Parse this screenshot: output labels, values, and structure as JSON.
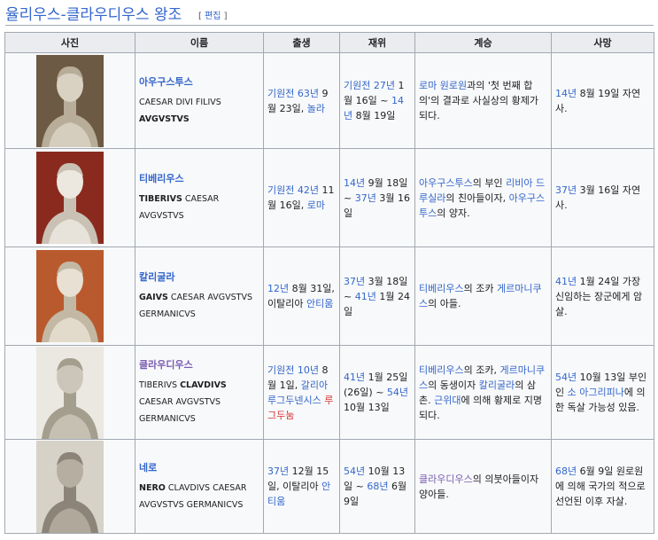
{
  "heading": {
    "title": "율리우스-클라우디우스 왕조",
    "edit_open": "[ ",
    "edit_label": "편집",
    "edit_close": " ]"
  },
  "table": {
    "headers": [
      "사진",
      "이름",
      "출생",
      "재위",
      "계승",
      "사망"
    ],
    "rows": [
      {
        "portrait_icon": "bust-portrait-augustus",
        "name": "아우구스투스",
        "latin": {
          "pre": "CAESAR DIVI FILIVS ",
          "bold": "AVGVSTVS",
          "post": ""
        },
        "birth": [
          {
            "t": "기원전 63년",
            "link": true
          },
          {
            "t": " 9월 23일, "
          },
          {
            "t": "놀라",
            "link": true
          }
        ],
        "reign": [
          {
            "t": "기원전 27년",
            "link": true
          },
          {
            "t": " 1월 16일 ~ "
          },
          {
            "t": "14년",
            "link": true
          },
          {
            "t": " 8월 19일"
          }
        ],
        "succession": [
          {
            "t": "로마 원로원",
            "link": true
          },
          {
            "t": "과의 '첫 번째 합의'의 결과로 사실상의 황제가 되다."
          }
        ],
        "death": [
          {
            "t": "14년",
            "link": true
          },
          {
            "t": " 8월 19일 자연사."
          }
        ]
      },
      {
        "portrait_icon": "bust-portrait-tiberius",
        "name": "티베리우스",
        "latin": {
          "pre": "",
          "bold": "TIBERIVS",
          "post": " CAESAR AVGVSTVS"
        },
        "birth": [
          {
            "t": "기원전 42년",
            "link": true
          },
          {
            "t": " 11월 16일, "
          },
          {
            "t": "로마",
            "link": true
          }
        ],
        "reign": [
          {
            "t": "14년",
            "link": true
          },
          {
            "t": " 9월 18일 ~ "
          },
          {
            "t": "37년",
            "link": true
          },
          {
            "t": " 3월 16일"
          }
        ],
        "succession": [
          {
            "t": "아우구스투스",
            "link": true
          },
          {
            "t": "의 부인 "
          },
          {
            "t": "리비아 드루실라",
            "link": true
          },
          {
            "t": "의 친아들이자, "
          },
          {
            "t": "아우구스투스",
            "link": true
          },
          {
            "t": "의 양자."
          }
        ],
        "death": [
          {
            "t": "37년",
            "link": true
          },
          {
            "t": " 3월 16일 자연사."
          }
        ]
      },
      {
        "portrait_icon": "bust-portrait-caligula",
        "name": "칼리굴라",
        "latin": {
          "pre": "",
          "bold": "GAIVS",
          "post": " CAESAR AVGVSTVS GERMANICVS"
        },
        "birth": [
          {
            "t": "12년",
            "link": true
          },
          {
            "t": " 8월 31일, 이탈리아 "
          },
          {
            "t": "안티움",
            "link": true
          }
        ],
        "reign": [
          {
            "t": "37년",
            "link": true
          },
          {
            "t": " 3월 18일 ~ "
          },
          {
            "t": "41년",
            "link": true
          },
          {
            "t": " 1월 24일"
          }
        ],
        "succession": [
          {
            "t": "티베리우스",
            "link": true
          },
          {
            "t": "의 조카 "
          },
          {
            "t": "게르마니쿠스",
            "link": true
          },
          {
            "t": "의 아들."
          }
        ],
        "death": [
          {
            "t": "41년",
            "link": true
          },
          {
            "t": " 1월 24일 가장 신임하는 장군에게 암살."
          }
        ]
      },
      {
        "portrait_icon": "bust-portrait-claudius",
        "name": "클라우디우스",
        "name_visited": true,
        "latin": {
          "pre": "TIBERIVS ",
          "bold": "CLAVDIVS",
          "post": " CAESAR AVGVSTVS GERMANICVS"
        },
        "birth": [
          {
            "t": "기원전 10년",
            "link": true
          },
          {
            "t": " 8월 1일, "
          },
          {
            "t": "갈리아 루그두넨시스",
            "link": true
          },
          {
            "t": " "
          },
          {
            "t": "루그두눔",
            "link": true,
            "new": true
          }
        ],
        "reign": [
          {
            "t": "41년",
            "link": true
          },
          {
            "t": " 1월 25일 (26일) ~ "
          },
          {
            "t": "54년",
            "link": true
          },
          {
            "t": " 10월 13일"
          }
        ],
        "succession": [
          {
            "t": "티베리우스",
            "link": true
          },
          {
            "t": "의 조카, "
          },
          {
            "t": "게르마니쿠스",
            "link": true
          },
          {
            "t": "의 동생이자 "
          },
          {
            "t": "칼리굴라",
            "link": true
          },
          {
            "t": "의 삼촌. "
          },
          {
            "t": "근위대",
            "link": true
          },
          {
            "t": "에 의해 황제로 지명되다."
          }
        ],
        "death": [
          {
            "t": "54년",
            "link": true
          },
          {
            "t": " 10월 13일 부인인 "
          },
          {
            "t": "소 아그리피나",
            "link": true
          },
          {
            "t": "에 의한 독살 가능성 있음."
          }
        ]
      },
      {
        "portrait_icon": "bust-portrait-nero",
        "name": "네로",
        "latin": {
          "pre": "",
          "bold": "NERO",
          "post": " CLAVDIVS CAESAR AVGVSTVS GERMANICVS"
        },
        "birth": [
          {
            "t": "37년",
            "link": true
          },
          {
            "t": " 12월 15일, 이탈리아 "
          },
          {
            "t": "안티움",
            "link": true
          }
        ],
        "reign": [
          {
            "t": "54년",
            "link": true
          },
          {
            "t": " 10월 13일 ~ "
          },
          {
            "t": "68년",
            "link": true
          },
          {
            "t": " 6월 9일"
          }
        ],
        "succession": [
          {
            "t": "클라우디우스",
            "link": true,
            "visited": true
          },
          {
            "t": "의 의붓아들이자 양아들."
          }
        ],
        "death": [
          {
            "t": "68년",
            "link": true
          },
          {
            "t": " 6월 9일 원로원에 의해 국가의 적으로 선언된 이후 자살."
          }
        ]
      }
    ]
  }
}
